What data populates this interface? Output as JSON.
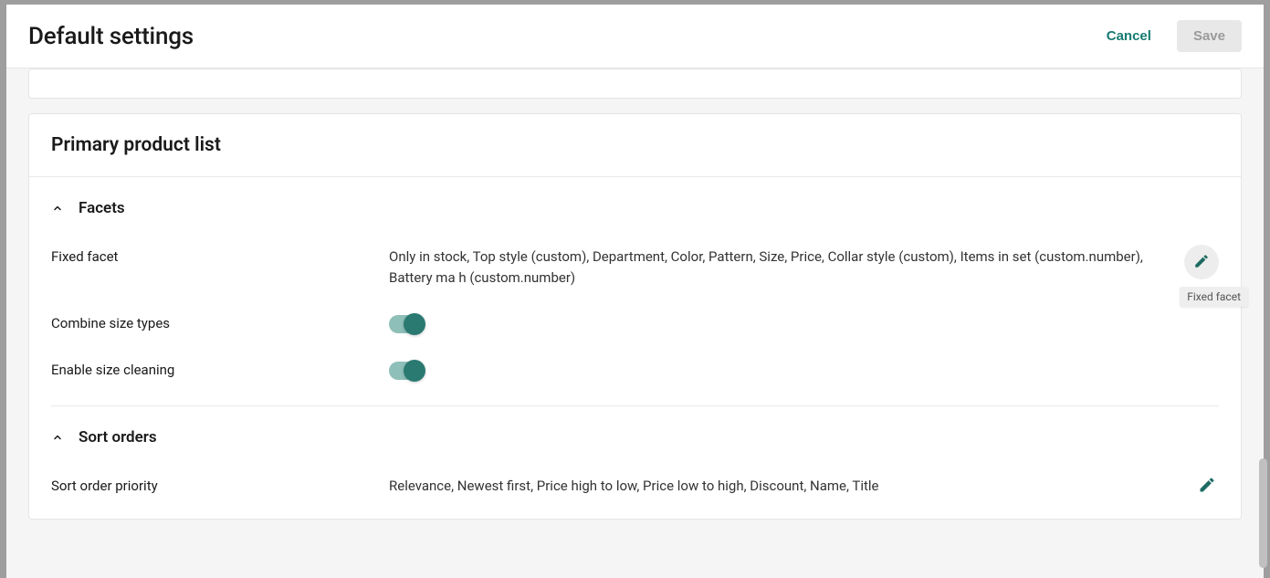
{
  "header": {
    "title": "Default settings",
    "cancel_label": "Cancel",
    "save_label": "Save"
  },
  "card": {
    "title": "Primary product list"
  },
  "facets": {
    "section_title": "Facets",
    "fixed_facet_label": "Fixed facet",
    "fixed_facet_value": "Only in stock, Top style (custom), Department, Color, Pattern, Size, Price, Collar style (custom), Items in set (custom.number), Battery ma h (custom.number)",
    "combine_size_label": "Combine size types",
    "combine_size_on": true,
    "enable_size_cleaning_label": "Enable size cleaning",
    "enable_size_cleaning_on": true,
    "edit_tooltip": "Fixed facet"
  },
  "sort_orders": {
    "section_title": "Sort orders",
    "priority_label": "Sort order priority",
    "priority_value": "Relevance, Newest first, Price high to low, Price low to high, Discount, Name, Title"
  }
}
